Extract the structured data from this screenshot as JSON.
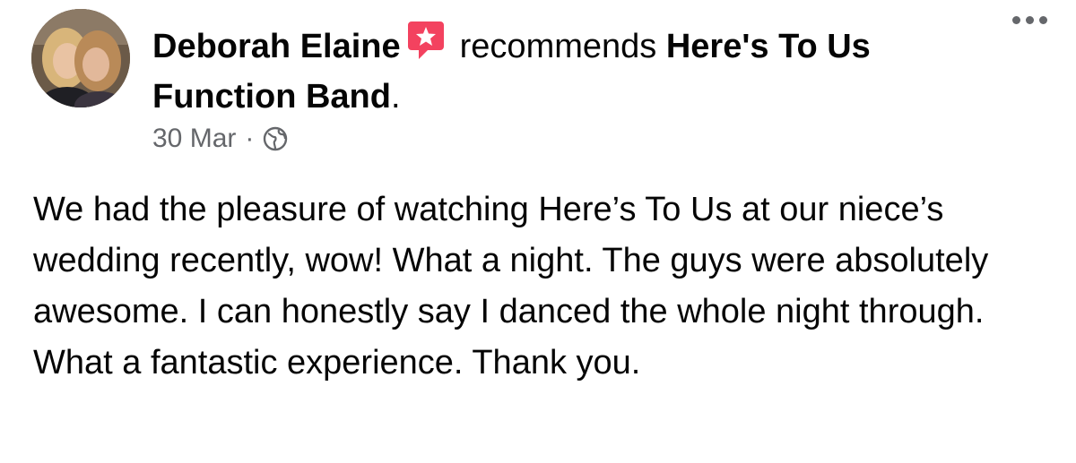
{
  "post": {
    "author": "Deborah Elaine",
    "verb": "recommends",
    "page_name": "Here's To Us Function Band",
    "page_suffix": ".",
    "date": "30 Mar",
    "separator": "·",
    "privacy_icon": "globe-icon",
    "recommend_icon": "recommendation-star-icon",
    "more_icon": "more-options-icon",
    "text": "We had the pleasure of watching Here’s To Us at our niece’s wedding recently, wow! What a night. The guys were absolutely awesome. I can honestly say I danced the whole night through. What a fantastic experience. Thank you."
  },
  "colors": {
    "recommend_icon": "#f3425f",
    "meta_text": "#65676b",
    "body_text": "#050505"
  }
}
